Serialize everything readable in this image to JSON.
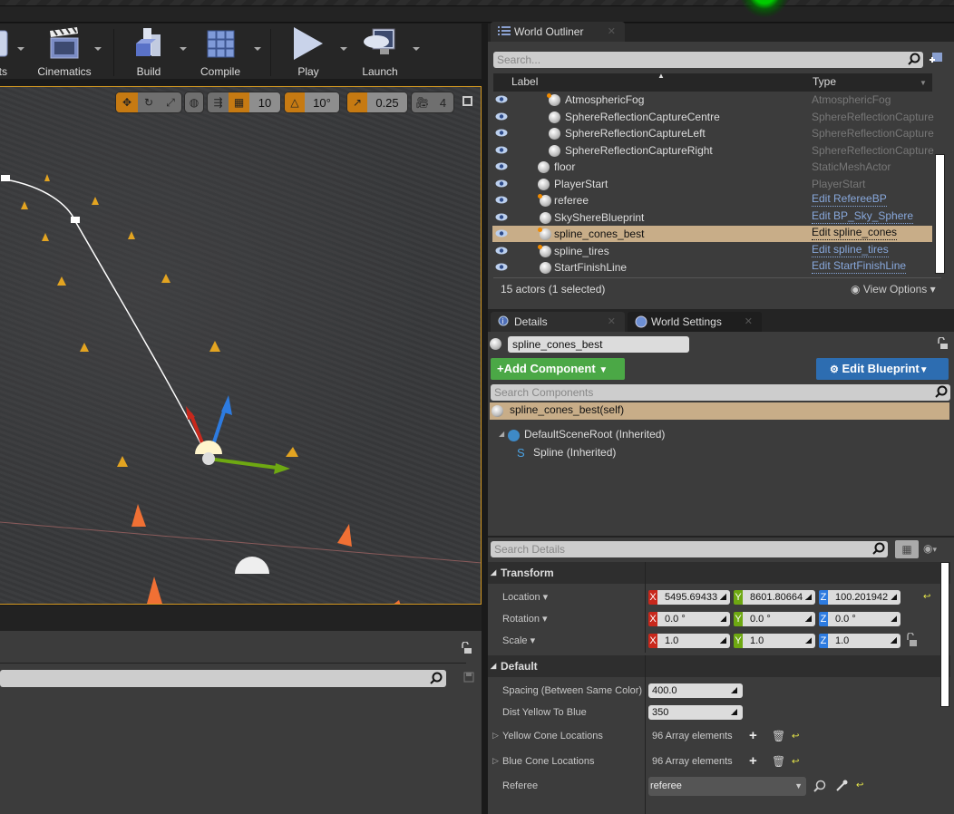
{
  "toolbar": {
    "buttons": [
      {
        "label": "nts",
        "icon": "content-icon"
      },
      {
        "label": "Cinematics",
        "icon": "clapperboard-icon"
      },
      {
        "label": "Build",
        "icon": "build-blocks-icon"
      },
      {
        "label": "Compile",
        "icon": "compile-cube-icon"
      },
      {
        "label": "Play",
        "icon": "play-icon"
      },
      {
        "label": "Launch",
        "icon": "gamepad-monitor-icon"
      }
    ]
  },
  "viewport": {
    "grid_snap": "10",
    "rotation_snap": "10°",
    "scale_snap": "0.25",
    "camera_speed": "4"
  },
  "outliner": {
    "tab_label": "World Outliner",
    "search_placeholder": "Search...",
    "col_label": "Label",
    "col_type": "Type",
    "rows": [
      {
        "label": "AtmosphericFog",
        "type": "AtmosphericFog",
        "link": false
      },
      {
        "label": "SphereReflectionCaptureCentre",
        "type": "SphereReflectionCapture",
        "link": false
      },
      {
        "label": "SphereReflectionCaptureLeft",
        "type": "SphereReflectionCapture",
        "link": false
      },
      {
        "label": "SphereReflectionCaptureRight",
        "type": "SphereReflectionCapture",
        "link": false
      },
      {
        "label": "floor",
        "type": "StaticMeshActor",
        "link": false
      },
      {
        "label": "PlayerStart",
        "type": "PlayerStart",
        "link": false
      },
      {
        "label": "referee",
        "type": "Edit RefereeBP",
        "link": true
      },
      {
        "label": "SkyShereBlueprint",
        "type": "Edit BP_Sky_Sphere",
        "link": true
      },
      {
        "label": "spline_cones_best",
        "type": "Edit spline_cones",
        "link": true,
        "selected": true
      },
      {
        "label": "spline_tires",
        "type": "Edit spline_tires",
        "link": true
      },
      {
        "label": "StartFinishLine",
        "type": "Edit StartFinishLine",
        "link": true
      }
    ],
    "status": "15 actors (1 selected)",
    "view_options": "View Options"
  },
  "details": {
    "tab_details": "Details",
    "tab_world_settings": "World Settings",
    "actor_name": "spline_cones_best",
    "add_component": "Add Component",
    "edit_blueprint": "Edit Blueprint",
    "search_components_placeholder": "Search Components",
    "self_component": "spline_cones_best(self)",
    "components": [
      {
        "label": "DefaultSceneRoot (Inherited)"
      },
      {
        "label": "Spline (Inherited)"
      }
    ],
    "search_details_placeholder": "Search Details",
    "transform": {
      "header": "Transform",
      "location_label": "Location",
      "rotation_label": "Rotation",
      "scale_label": "Scale",
      "location": {
        "x": "5495.69433",
        "y": "8601.80664",
        "z": "100.201942"
      },
      "rotation": {
        "x": "0.0 °",
        "y": "0.0 °",
        "z": "0.0 °"
      },
      "scale": {
        "x": "1.0",
        "y": "1.0",
        "z": "1.0"
      }
    },
    "default": {
      "header": "Default",
      "spacing_label": "Spacing (Between Same Color)",
      "spacing_value": "400.0",
      "dist_label": "Dist Yellow To Blue",
      "dist_value": "350",
      "yellow_label": "Yellow Cone Locations",
      "yellow_value": "96 Array elements",
      "blue_label": "Blue Cone Locations",
      "blue_value": "96 Array elements",
      "referee_label": "Referee",
      "referee_value": "referee"
    }
  },
  "colors": {
    "accent_orange": "#c67a12",
    "selection": "#c8ad88",
    "add_component_green": "#4ba846",
    "edit_blueprint_blue": "#2d6db1",
    "axis_x": "#c8281c",
    "axis_y": "#6ea812",
    "axis_z": "#2d7be0"
  }
}
